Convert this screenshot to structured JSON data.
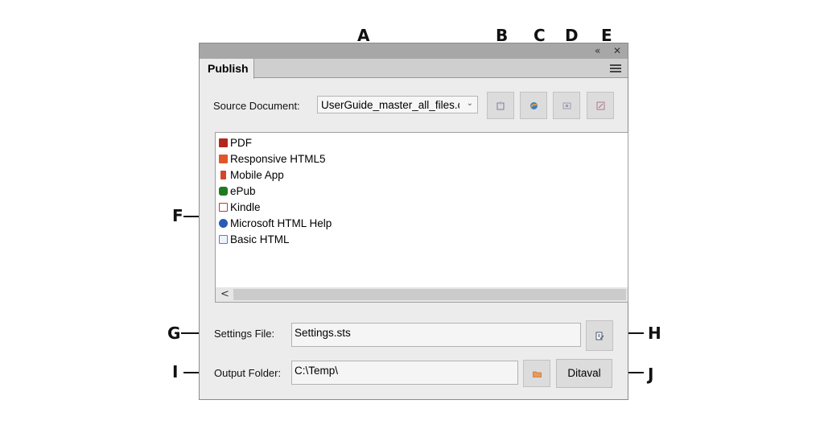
{
  "callouts": {
    "a": "A",
    "b": "B",
    "c": "C",
    "d": "D",
    "e": "E",
    "f": "F",
    "g": "G",
    "h": "H",
    "i": "I",
    "j": "J"
  },
  "window": {
    "collapse_icon": "«",
    "close_icon": "✕"
  },
  "tab": {
    "label": "Publish"
  },
  "source": {
    "label": "Source Document:",
    "value": "UserGuide_master_all_files.c",
    "arrow": "⌄"
  },
  "toolbar_icons": [
    "add-output-icon",
    "generate-icon",
    "view-output-icon",
    "edit-settings-icon"
  ],
  "outputs": [
    {
      "label": "PDF",
      "icon": "pdf-icon",
      "color": "#b3261e"
    },
    {
      "label": "Responsive HTML5",
      "icon": "html5-icon",
      "color": "#e2542b"
    },
    {
      "label": "Mobile App",
      "icon": "mobile-app-icon",
      "color": "#d2462c"
    },
    {
      "label": "ePub",
      "icon": "epub-icon",
      "color": "#1f7a20"
    },
    {
      "label": "Kindle",
      "icon": "kindle-icon",
      "color": "#c0392b"
    },
    {
      "label": "Microsoft HTML Help",
      "icon": "chm-icon",
      "color": "#2a5ab8"
    },
    {
      "label": "Basic HTML",
      "icon": "basic-html-icon",
      "color": "#5a7fc0"
    }
  ],
  "scrollbar": {
    "left_arrow": "<"
  },
  "settings": {
    "label": "Settings File:",
    "value": "Settings.sts"
  },
  "output_folder": {
    "label": "Output Folder:",
    "value": "C:\\Temp\\",
    "ditaval_label": "Ditaval"
  }
}
